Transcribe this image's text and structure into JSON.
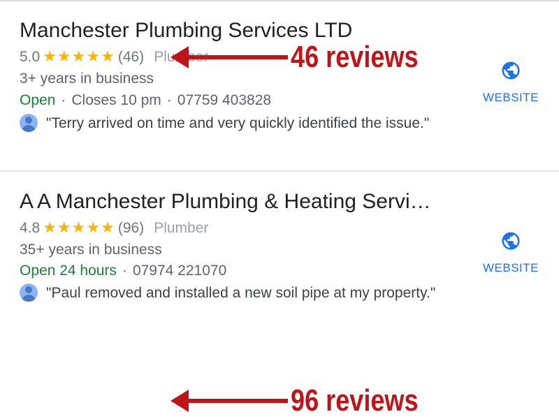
{
  "listings": [
    {
      "name": "Manchester Plumbing Services LTD",
      "rating": "5.0",
      "stars": "★★★★★",
      "review_count": "(46)",
      "category": "Plumber",
      "years": "3+ years in business",
      "open_status": "Open",
      "hours_detail": "Closes 10 pm",
      "phone": "07759 403828",
      "review_snippet": "\"Terry arrived on time and very quickly identified the issue.\"",
      "website_label": "WEBSITE",
      "annotation": "46 reviews"
    },
    {
      "name": "A A Manchester Plumbing & Heating Servi…",
      "rating": "4.8",
      "stars": "★★★★★",
      "review_count": "(96)",
      "category": "Plumber",
      "years": "35+ years in business",
      "open_status": "Open 24 hours",
      "phone": "07974 221070",
      "review_snippet": "\"Paul removed and installed a new soil pipe at my property.\"",
      "website_label": "WEBSITE",
      "annotation": "96 reviews"
    }
  ],
  "separator": "·",
  "colors": {
    "star": "#f9b409",
    "open": "#188038",
    "link": "#1a73e8",
    "annotation": "#c0141b"
  },
  "icons": {
    "website": "globe-icon",
    "reviewer": "avatar-icon",
    "annotation_pointer": "arrow-left-icon"
  }
}
